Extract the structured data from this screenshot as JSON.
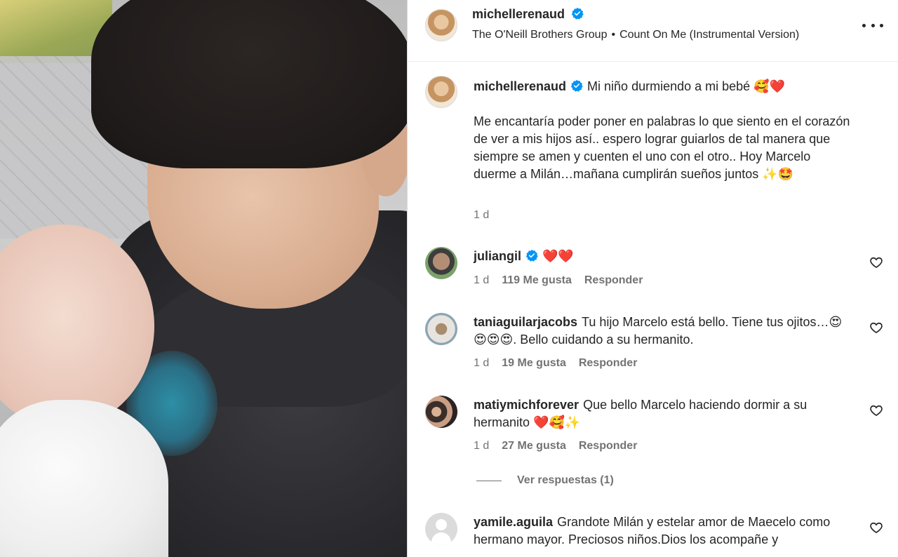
{
  "post": {
    "username": "michellerenaud",
    "audio_artist": "The O'Neill Brothers Group",
    "audio_separator": "•",
    "audio_track": "Count On Me (Instrumental Version)"
  },
  "caption": {
    "username": "michellerenaud",
    "first_line": "Mi niño durmiendo a mi bebé 🥰❤️",
    "body": "Me encantaría poder poner en palabras lo que siento en el corazón de ver a mis hijos así.. espero lograr guiarlos de tal manera que siempre se amen y cuenten el uno con el otro.. Hoy Marcelo duerme a Milán…mañana cumplirán sueños juntos ✨🤩",
    "time": "1 d"
  },
  "comments": [
    {
      "username": "juliangil",
      "verified": true,
      "text": "❤️❤️",
      "time": "1 d",
      "likes": "119 Me gusta",
      "reply": "Responder"
    },
    {
      "username": "taniaguilarjacobs",
      "verified": false,
      "text": "Tu hijo Marcelo está bello. Tiene tus ojitos…😍😍😍😍. Bello cuidando a su hermanito.",
      "time": "1 d",
      "likes": "19 Me gusta",
      "reply": "Responder"
    },
    {
      "username": "matiymichforever",
      "verified": false,
      "text": "Que bello Marcelo haciendo dormir a su hermanito ❤️🥰✨",
      "time": "1 d",
      "likes": "27 Me gusta",
      "reply": "Responder"
    },
    {
      "username": "yamile.aguila",
      "verified": false,
      "text": "Grandote Milán y estelar amor de Maecelo como hermano mayor. Preciosos niños.Dios los acompañe y"
    }
  ],
  "view_replies": "Ver respuestas (1)",
  "colors": {
    "verified": "#0095f6",
    "muted": "#737373",
    "text": "#262626",
    "border": "#dbdbdb"
  }
}
